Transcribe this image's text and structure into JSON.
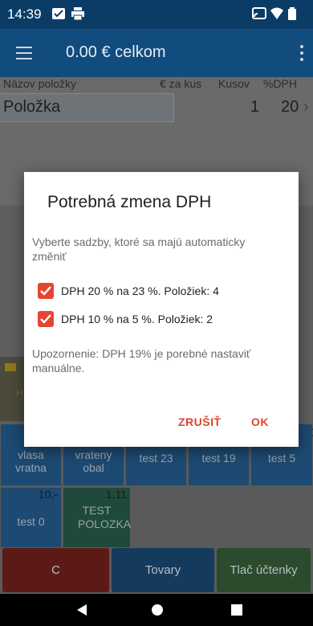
{
  "status_bar": {
    "time": "14:39"
  },
  "app_bar": {
    "title": "0.00 € celkom"
  },
  "form": {
    "headers": {
      "name": "Názov položky",
      "unit_price": "€ za kus",
      "qty": "Kusov",
      "vat": "%DPH"
    },
    "name_value": "Položka",
    "qty_value": "1",
    "vat_value": "20"
  },
  "dialog": {
    "title": "Potrebná zmena DPH",
    "message": "Vyberte sadzby, ktoré sa majú automaticky změniť",
    "options": [
      {
        "label": "DPH 20 % na 23 %. Položiek: 4",
        "checked": true
      },
      {
        "label": "DPH 10 % na 5 %. Položiek: 2",
        "checked": true
      }
    ],
    "warning": "Upozornenie: DPH 19% je porebné nastaviť manuálne.",
    "cancel_label": "ZRUŠIŤ",
    "ok_label": "OK"
  },
  "grid": {
    "row_top_price": "10",
    "tiles": [
      {
        "label": "vlasa vratna"
      },
      {
        "label": "vrateny obal"
      },
      {
        "label": "test 23"
      },
      {
        "label": "test 19"
      },
      {
        "label": "test 5"
      }
    ],
    "tile_test0": {
      "label": "test 0",
      "price": "10,-"
    },
    "tile_testpol": {
      "label": "TEST POLOZKA",
      "price": "1,11"
    },
    "left_partial": "H"
  },
  "actions": {
    "clear": "C",
    "products": "Tovary",
    "print": "Tlač účtenky"
  },
  "colors": {
    "accent": "#e54632",
    "app_bar": "#124b7e",
    "status_bar": "#0b3c66"
  }
}
